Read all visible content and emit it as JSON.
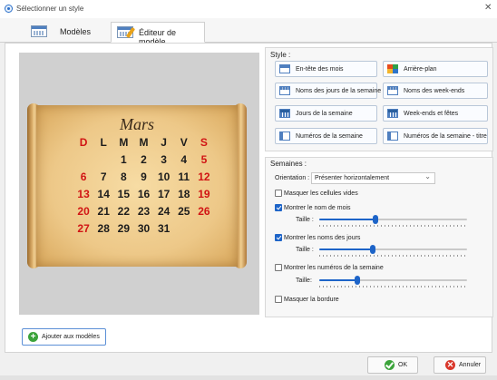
{
  "window": {
    "title": "Sélectionner un style",
    "close_glyph": "✕"
  },
  "tabs": [
    {
      "label": "Modèles",
      "icon": "calendar-icon"
    },
    {
      "label": "Éditeur de modèle",
      "icon": "calendar-edit-icon"
    }
  ],
  "preview": {
    "month": "Mars",
    "day_headers": [
      "D",
      "L",
      "M",
      "M",
      "J",
      "V",
      "S"
    ],
    "weeks": [
      [
        "",
        "",
        "",
        "1",
        "2",
        "3",
        "4",
        "5"
      ],
      [
        "6",
        "7",
        "8",
        "9",
        "10",
        "11",
        "12"
      ],
      [
        "13",
        "14",
        "15",
        "16",
        "17",
        "18",
        "19"
      ],
      [
        "20",
        "21",
        "22",
        "23",
        "24",
        "25",
        "26"
      ],
      [
        "27",
        "28",
        "29",
        "30",
        "31",
        "",
        ""
      ]
    ],
    "weekend_color": "#d11414",
    "weekday_color": "#1c1c1c"
  },
  "style_group": {
    "title": "Style :",
    "buttons": [
      {
        "label": "En-tête des mois",
        "icon": "month-header-icon"
      },
      {
        "label": "Arrière-plan",
        "icon": "background-icon"
      },
      {
        "label": "Noms des jours de la semaine",
        "icon": "weekday-names-icon"
      },
      {
        "label": "Noms des week-ends",
        "icon": "weekend-names-icon"
      },
      {
        "label": "Jours de la semaine",
        "icon": "weekdays-icon"
      },
      {
        "label": "Week-ends et fêtes",
        "icon": "weekends-holidays-icon"
      },
      {
        "label": "Numéros de la semaine",
        "icon": "week-numbers-icon"
      },
      {
        "label": "Numéros de la semaine - titre",
        "icon": "week-numbers-title-icon"
      }
    ]
  },
  "weeks_group": {
    "title": "Semaines :",
    "orientation_label": "Orientation :",
    "orientation_value": "Présenter horizontalement",
    "hide_empty_cells": {
      "label": "Masquer les cellules vides",
      "checked": false
    },
    "show_month_name": {
      "label": "Montrer le nom de mois",
      "checked": true,
      "size_label": "Taille :",
      "size_level": 0.38
    },
    "show_day_names": {
      "label": "Montrer les noms des jours",
      "checked": true,
      "size_label": "Taille :",
      "size_level": 0.36
    },
    "show_week_numbers": {
      "label": "Montrer les numéros de la semaine",
      "checked": false,
      "size_label": "Taille:",
      "size_level": 0.26
    },
    "hide_border": {
      "label": "Masquer la bordure",
      "checked": false
    }
  },
  "add_button": {
    "label": "Ajouter aux modèles"
  },
  "footer": {
    "ok_label": "OK",
    "cancel_label": "Annuler"
  },
  "colors": {
    "accent": "#1d64c8",
    "ok_green": "#3ba33a",
    "cancel_red": "#d9372b"
  }
}
